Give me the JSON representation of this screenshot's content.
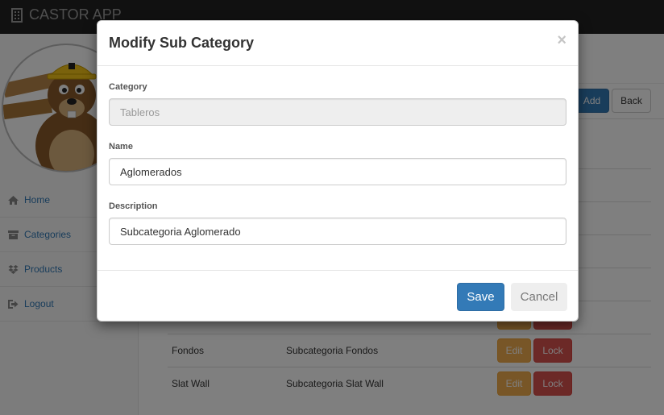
{
  "app": {
    "title": "CASTOR APP"
  },
  "sidebar": {
    "items": [
      {
        "label": "Home",
        "icon": "home-icon"
      },
      {
        "label": "Categories",
        "icon": "archive-icon"
      },
      {
        "label": "Products",
        "icon": "dropbox-icon"
      },
      {
        "label": "Logout",
        "icon": "sign-out-icon"
      }
    ]
  },
  "toolbar": {
    "add_label": "Add",
    "back_label": "Back"
  },
  "table": {
    "rows": [
      {
        "name": "",
        "description": ""
      },
      {
        "name": "",
        "description": ""
      },
      {
        "name": "",
        "description": ""
      },
      {
        "name": "",
        "description": ""
      },
      {
        "name": "",
        "description": ""
      },
      {
        "name": "Fondos",
        "description": "Subcategoria Fondos",
        "edit": "Edit",
        "lock": "Lock"
      },
      {
        "name": "Slat Wall",
        "description": "Subcategoria Slat Wall",
        "edit": "Edit",
        "lock": "Lock"
      }
    ]
  },
  "modal": {
    "title": "Modify Sub Category",
    "close": "×",
    "category": {
      "label": "Category",
      "value": "Tableros"
    },
    "name": {
      "label": "Name",
      "value": "Aglomerados"
    },
    "description": {
      "label": "Description",
      "value": "Subcategoria Aglomerado"
    },
    "save_label": "Save",
    "cancel_label": "Cancel"
  },
  "colors": {
    "primary": "#337ab7",
    "warning": "#f0ad4e",
    "danger": "#d9534f",
    "navbar": "#222222"
  }
}
